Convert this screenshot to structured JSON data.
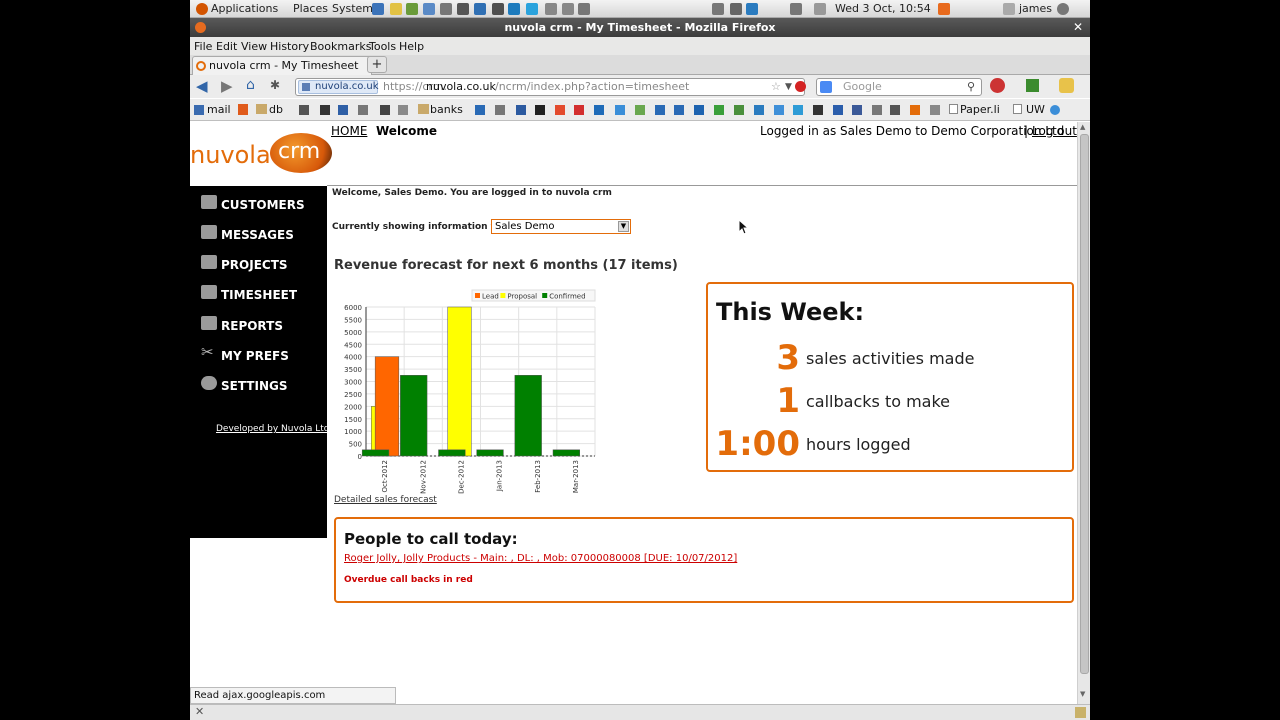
{
  "os_panel": {
    "menus": [
      "Applications",
      "Places",
      "System"
    ],
    "clock": "Wed  3 Oct, 10:54",
    "user": "james"
  },
  "window": {
    "title": "nuvola crm - My Timesheet - Mozilla Firefox",
    "menu": [
      "File",
      "Edit",
      "View",
      "History",
      "Bookmarks",
      "Tools",
      "Help"
    ],
    "tab_title": "nuvola crm - My Timesheet",
    "new_tab": "+",
    "site_identity": "nuvola.co.uk",
    "url_prefix": "https://crm.",
    "url_domain": "nuvola.co.uk",
    "url_path": "/ncrm/index.php?action=timesheet",
    "search_placeholder": "Google",
    "bookmarks": [
      "mail",
      "db",
      "banks",
      "Paper.li",
      "UW"
    ]
  },
  "app": {
    "logo_text": "nuvola",
    "logo_badge": "crm",
    "nav_home": "HOME",
    "nav_current": "Welcome",
    "login_info": "Logged in as Sales Demo to Demo Corporation Ltd",
    "separator": "|",
    "logout": "Log out",
    "sidebar": [
      {
        "label": "CUSTOMERS",
        "icon": "customers-icon"
      },
      {
        "label": "MESSAGES",
        "icon": "messages-icon"
      },
      {
        "label": "PROJECTS",
        "icon": "projects-icon"
      },
      {
        "label": "TIMESHEET",
        "icon": "timesheet-icon"
      },
      {
        "label": "REPORTS",
        "icon": "reports-icon"
      },
      {
        "label": "MY PREFS",
        "icon": "tools-icon"
      },
      {
        "label": "SETTINGS",
        "icon": "settings-icon"
      }
    ],
    "developed_by": "Developed by Nuvola Ltd",
    "welcome": "Welcome, Sales Demo. You are logged in to nuvola crm",
    "showing_label": "Currently showing information for",
    "showing_value": "Sales Demo",
    "forecast_title": "Revenue forecast for next 6 months (17 items)",
    "detailed_link": "Detailed sales forecast",
    "week": {
      "title": "This Week:",
      "items": [
        {
          "value": "3",
          "label": "sales activities made"
        },
        {
          "value": "1",
          "label": "callbacks to make"
        },
        {
          "value": "1:00",
          "label": "hours logged"
        }
      ]
    },
    "people": {
      "title": "People to call today:",
      "entry": "Roger Jolly, Jolly Products - Main: , DL: , Mob: 07000080008 [DUE: 10/07/2012]",
      "overdue": "Overdue call backs in red"
    }
  },
  "status_text": "Read ajax.googleapis.com",
  "chart_data": {
    "type": "bar",
    "categories": [
      "Oct-2012",
      "Nov-2012",
      "Dec-2012",
      "Jan-2013",
      "Feb-2013",
      "Mar-2013"
    ],
    "series": [
      {
        "name": "Lead",
        "color": "#ff6600",
        "values": [
          4000,
          0,
          0,
          0,
          0,
          0
        ]
      },
      {
        "name": "Proposal",
        "color": "#ffff00",
        "values": [
          2000,
          0,
          6000,
          0,
          0,
          0
        ]
      },
      {
        "name": "Confirmed",
        "color": "#008000",
        "values": [
          250,
          3250,
          250,
          250,
          3250,
          250
        ]
      }
    ],
    "yticks": [
      "0",
      "500",
      "1000",
      "1500",
      "2000",
      "2500",
      "3000",
      "3500",
      "4000",
      "4500",
      "5000",
      "5500",
      "6000"
    ],
    "ylim": [
      0,
      6000
    ],
    "legend": "top-right",
    "grid": true
  }
}
